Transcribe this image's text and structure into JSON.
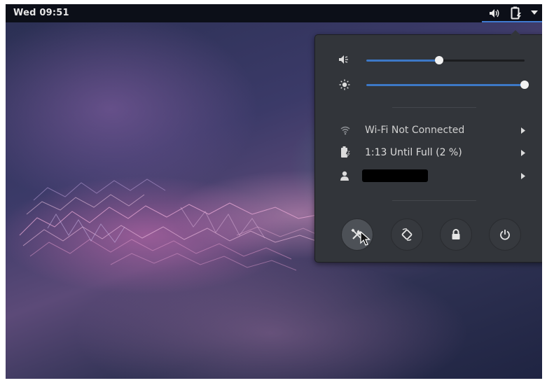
{
  "topbar": {
    "clock": "Wed 09:51"
  },
  "tray": {
    "icons": [
      "volume-icon",
      "battery-charging-icon",
      "dropdown-caret-icon"
    ],
    "active_underline_color": "#3f7ad0"
  },
  "system_menu": {
    "volume_slider": {
      "icon": "volume-low-icon",
      "level": 0.46
    },
    "brightness_slider": {
      "icon": "brightness-icon",
      "level": 1.0
    },
    "items": [
      {
        "icon": "wifi-icon",
        "label": "Wi-Fi Not Connected"
      },
      {
        "icon": "battery-charging-icon",
        "label": "1:13 Until Full (2 %)"
      },
      {
        "icon": "user-icon",
        "label": ""
      }
    ],
    "actions": [
      {
        "icon": "settings-tools-icon",
        "state": "hover"
      },
      {
        "icon": "rotation-lock-icon"
      },
      {
        "icon": "lock-icon"
      },
      {
        "icon": "power-icon"
      }
    ],
    "accent_color": "#3d78c6",
    "background_color": "#32353a"
  }
}
